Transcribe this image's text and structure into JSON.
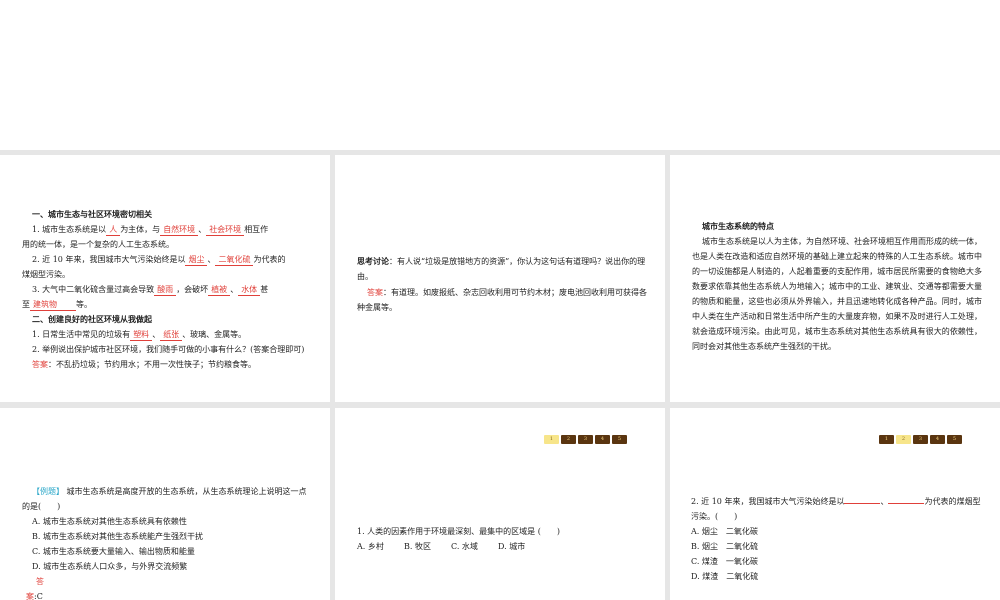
{
  "slide1": {
    "h1": "一、城市生态与社区环境密切相关",
    "q1": {
      "a": "1. 城市生态系统是以",
      "b1": "人",
      "c": "为主体，与",
      "b2": "自然环境",
      "d": "、",
      "b3": "社会环境",
      "e": "相互作",
      "f": "用的统一体，是一个复杂的人工生态系统。"
    },
    "q2": {
      "a": "2. 近 10 年来，我国城市大气污染始终是以",
      "b1": "烟尘",
      "c": "、",
      "b2": "二氧化硫",
      "d": "为代表的",
      "e": "煤烟型污染。"
    },
    "q3": {
      "a": "3. 大气中二氧化硫含量过高会导致",
      "b1": "酸雨",
      "c": "，会破坏",
      "b2": "植被",
      "d": "、",
      "b3": "水体",
      "e": "甚",
      "f": "至",
      "b4": "建筑物",
      "g": "等。"
    },
    "h2": "二、创建良好的社区环境从我做起",
    "q4": {
      "a": "1. 日常生活中常见的垃圾有",
      "b1": "塑料",
      "c": "、",
      "b2": "纸张",
      "d": "、玻璃、金属等。"
    },
    "q5": "2. 举例说出保护城市社区环境，我们随手可做的小事有什么？(答案合理即可)",
    "ans_label": "答案",
    "ans": "：不乱扔垃圾；节约用水；不用一次性筷子；节约粮食等。"
  },
  "slide2": {
    "label": "思考讨论",
    "q": "：有人说“垃圾是放错地方的资源”，你认为这句话有道理吗？说出你的理由。",
    "ans_label": "答案",
    "ans": "：有道理。如废报纸、杂志回收利用可节约木材；废电池回收利用可获得各种金属等。"
  },
  "slide3": {
    "title": "城市生态系统的特点",
    "body": "城市生态系统是以人为主体，为自然环境、社会环境相互作用而形成的统一体，也是人类在改造和适应自然环境的基础上建立起来的特殊的人工生态系统。城市中的一切设施都是人制造的，人起着重要的支配作用，城市居民所需要的食物绝大多数要求依靠其他生态系统人为地输入；城市中的工业、建筑业、交通等都需要大量的物质和能量，这些也必须从外界输入，并且迅速地转化成各种产品。同时，城市中人类在生产活动和日常生活中所产生的大量废弃物，如果不及时进行人工处理，就会造成环境污染。由此可见，城市生态系统对其他生态系统具有很大的依赖性，同时会对其他生态系统产生强烈的干扰。"
  },
  "slide4": {
    "tag": "【例题】",
    "q": " 城市生态系统是高度开放的生态系统，从生态系统理论上说明这一点的是(　　)",
    "options": [
      "A. 城市生态系统对其他生态系统具有依赖性",
      "B. 城市生态系统对其他生态系统能产生强烈干扰",
      "C. 城市生态系统要大量输入、输出物质和能量",
      "D. 城市生态系统人口众多，与外界交流频繁"
    ],
    "ans_label1": "答",
    "ans_label2": "案",
    "ans": ":C"
  },
  "slide5": {
    "nav": [
      "1",
      "2",
      "3",
      "4",
      "5"
    ],
    "active": 1,
    "q": "1. 人类的因素作用于环境最深刻、最集中的区域是 (　　)",
    "options": [
      "A. 乡村",
      "B. 牧区",
      "C. 水域",
      "D. 城市"
    ]
  },
  "slide6": {
    "nav": [
      "1",
      "2",
      "3",
      "4",
      "5"
    ],
    "active": 2,
    "q_a": "2. 近 10 年来，我国城市大气污染始终是以",
    "q_b": "、",
    "q_c": "为代表的煤烟型",
    "q_d": "污染。(　　)",
    "options": [
      "A. 烟尘　二氧化碳",
      "B. 烟尘　二氧化硫",
      "C. 煤渣　一氧化碳",
      "D. 煤渣　二氧化硫"
    ]
  }
}
